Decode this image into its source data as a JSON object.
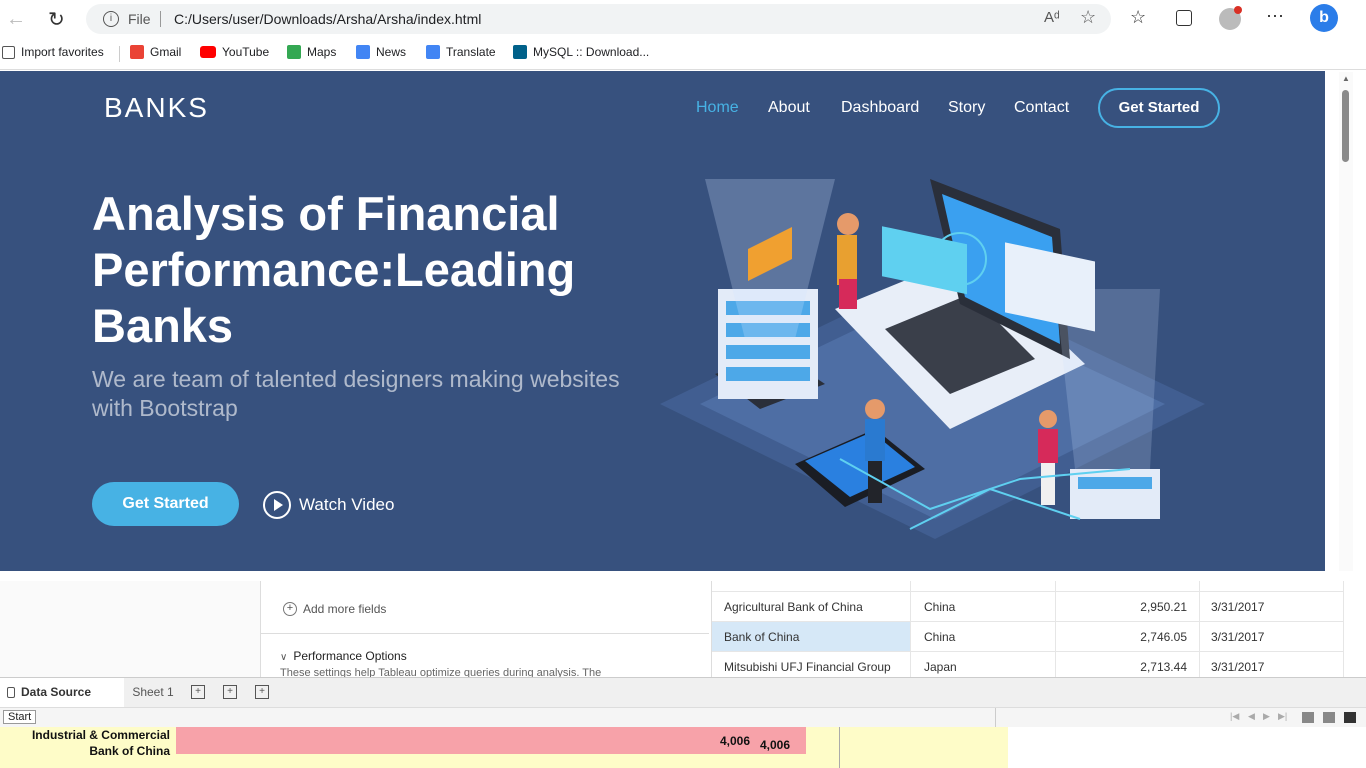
{
  "browser": {
    "info_label": "File",
    "url": "C:/Users/user/Downloads/Arsha/Arsha/index.html",
    "favorites": [
      {
        "label": "Import favorites",
        "color": "#555555"
      },
      {
        "label": "Gmail",
        "color": "#ea4335"
      },
      {
        "label": "YouTube",
        "color": "#ff0000"
      },
      {
        "label": "Maps",
        "color": "#34a853"
      },
      {
        "label": "News",
        "color": "#4285f4"
      },
      {
        "label": "Translate",
        "color": "#4285f4"
      },
      {
        "label": "MySQL :: Download...",
        "color": "#00618a"
      }
    ]
  },
  "site": {
    "logo": "BANKS",
    "nav": [
      "Home",
      "About",
      "Dashboard",
      "Story",
      "Contact"
    ],
    "nav_cta": "Get Started",
    "title": "Analysis of Financial Performance:Leading Banks",
    "subtitle": "We are team of talented designers making websites with Bootstrap",
    "cta": "Get Started",
    "watch": "Watch Video",
    "colors": {
      "bg": "#37517e",
      "accent": "#47b2e4",
      "active_nav": "#47b2e4"
    }
  },
  "tableau": {
    "add_fields": "Add more fields",
    "perf_title": "Performance Options",
    "perf_desc": "These settings help Tableau optimize queries during analysis. The",
    "rows": [
      {
        "bank": "Agricultural Bank of China",
        "country": "China",
        "value": "2,950.21",
        "date": "3/31/2017"
      },
      {
        "bank": "Bank of China",
        "country": "China",
        "value": "2,746.05",
        "date": "3/31/2017"
      },
      {
        "bank": "Mitsubishi UFJ Financial Group",
        "country": "Japan",
        "value": "2,713.44",
        "date": "3/31/2017"
      }
    ],
    "tabs": {
      "data_source": "Data Source",
      "sheet": "Sheet 1"
    },
    "tooltip": "Start",
    "viz": {
      "bank_line1": "Industrial & Commercial",
      "bank_line2": "Bank of China",
      "value_a": "4,006",
      "value_b": "4,006"
    }
  }
}
